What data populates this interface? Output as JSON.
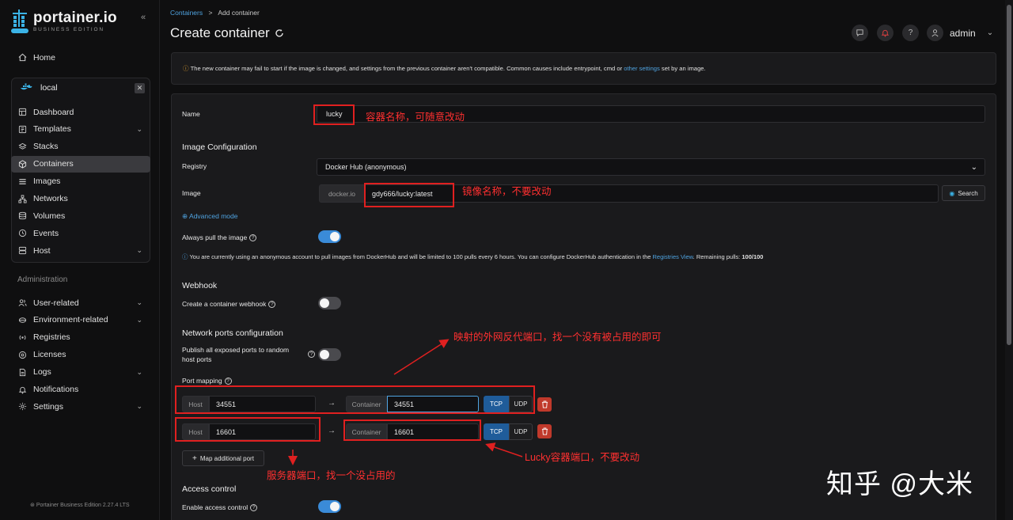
{
  "brand": {
    "name": "portainer.io",
    "edition": "BUSINESS EDITION"
  },
  "sidebar": {
    "home": "Home",
    "environment": "local",
    "env_items": [
      {
        "label": "Dashboard",
        "icon": "dashboard-icon"
      },
      {
        "label": "Templates",
        "icon": "templates-icon",
        "expandable": true
      },
      {
        "label": "Stacks",
        "icon": "stacks-icon"
      },
      {
        "label": "Containers",
        "icon": "containers-icon",
        "active": true
      },
      {
        "label": "Images",
        "icon": "images-icon"
      },
      {
        "label": "Networks",
        "icon": "networks-icon"
      },
      {
        "label": "Volumes",
        "icon": "volumes-icon"
      },
      {
        "label": "Events",
        "icon": "events-icon"
      },
      {
        "label": "Host",
        "icon": "host-icon",
        "expandable": true
      }
    ],
    "admin_label": "Administration",
    "admin_items": [
      {
        "label": "User-related",
        "icon": "users-icon",
        "expandable": true
      },
      {
        "label": "Environment-related",
        "icon": "environment-icon",
        "expandable": true
      },
      {
        "label": "Registries",
        "icon": "registries-icon"
      },
      {
        "label": "Licenses",
        "icon": "licenses-icon"
      },
      {
        "label": "Logs",
        "icon": "logs-icon",
        "expandable": true
      },
      {
        "label": "Notifications",
        "icon": "bell-icon"
      },
      {
        "label": "Settings",
        "icon": "gear-icon",
        "expandable": true
      }
    ],
    "version": "Portainer Business Edition 2.27.4 LTS"
  },
  "header": {
    "breadcrumb_link": "Containers",
    "breadcrumb_sep": ">",
    "breadcrumb_current": "Add container",
    "title": "Create container",
    "user": "admin"
  },
  "warning": {
    "text_before": "The new container may fail to start if the image is changed, and settings from the previous container aren't compatible. Common causes include entrypoint, cmd or ",
    "link": "other settings",
    "text_after": " set by an image."
  },
  "form": {
    "name_label": "Name",
    "name_value": "lucky",
    "image_config_title": "Image Configuration",
    "registry_label": "Registry",
    "registry_value": "Docker Hub (anonymous)",
    "image_label": "Image",
    "image_prefix": "docker.io",
    "image_value": "gdy666/lucky:latest",
    "search_label": "Search",
    "advanced_mode": "Advanced mode",
    "always_pull_label": "Always pull the image",
    "always_pull_on": true,
    "dockerhub_info_before": "You are currently using an anonymous account to pull images from DockerHub and will be limited to 100 pulls every 6 hours. You can configure DockerHub authentication in the ",
    "dockerhub_info_link": "Registries View",
    "dockerhub_info_mid": ". Remaining pulls: ",
    "dockerhub_info_pulls": "100/100",
    "webhook_title": "Webhook",
    "webhook_label": "Create a container webhook",
    "webhook_on": false,
    "network_title": "Network ports configuration",
    "publish_label_1": "Publish all exposed ports to random",
    "publish_label_2": "host ports",
    "publish_on": false,
    "port_mapping_label": "Port mapping",
    "ports": [
      {
        "host_label": "Host",
        "host": "34551",
        "container_label": "Container",
        "container": "34551",
        "tcp": "TCP",
        "udp": "UDP"
      },
      {
        "host_label": "Host",
        "host": "16601",
        "container_label": "Container",
        "container": "16601",
        "tcp": "TCP",
        "udp": "UDP"
      }
    ],
    "map_additional": "Map additional port",
    "access_title": "Access control",
    "access_label": "Enable access control",
    "access_on": true
  },
  "annotations": {
    "name_note": "容器名称，可随意改动",
    "image_note": "镜像名称，不要改动",
    "external_port_note": "映射的外网反代端口，找一个没有被占用的即可",
    "server_port_note": "服务器端口，找一个没占用的",
    "lucky_port_note": "Lucky容器端口，不要改动",
    "watermark": "知乎 @大米"
  },
  "colors": {
    "accent": "#3a8bd8",
    "annotation": "#e02020",
    "link": "#4fa3e0"
  }
}
